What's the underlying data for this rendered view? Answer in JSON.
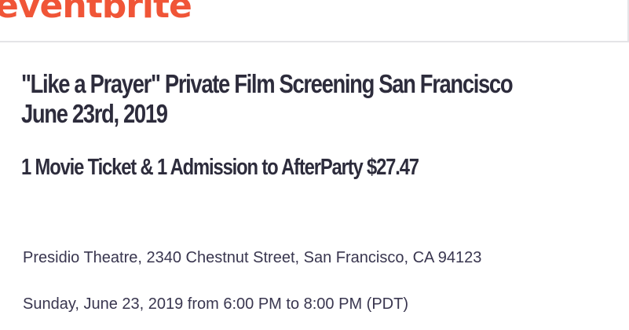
{
  "header": {
    "logo_text": "eventbrite",
    "brand_color": "#f05537"
  },
  "event": {
    "title_line1": "\"Like a Prayer\" Private Film Screening San Francisco",
    "title_line2": "June 23rd, 2019",
    "ticket": "1 Movie Ticket & 1 Admission to AfterParty $27.47",
    "address": "Presidio Theatre, 2340 Chestnut Street, San Francisco, CA 94123",
    "datetime": "Sunday, June 23, 2019 from 6:00 PM to 8:00 PM (PDT)"
  },
  "colors": {
    "text_dark": "#2d2c3c",
    "text_body": "#39364f",
    "divider": "#e4e4e7"
  }
}
